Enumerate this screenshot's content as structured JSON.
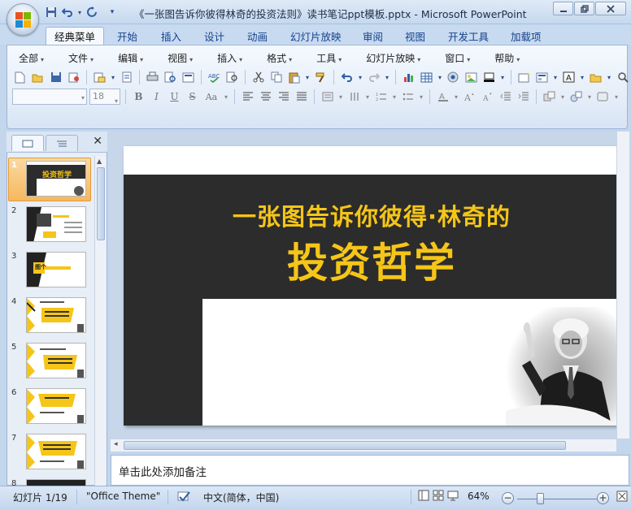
{
  "window": {
    "title": "《一张图告诉你彼得林奇的投资法则》读书笔记ppt模板.pptx - Microsoft PowerPoint",
    "controls": [
      "minimize",
      "restore",
      "close"
    ]
  },
  "quick_access": [
    "save-icon",
    "undo-icon",
    "redo-icon",
    "customize-icon"
  ],
  "ribbon_tabs": [
    "经典菜单",
    "开始",
    "插入",
    "设计",
    "动画",
    "幻灯片放映",
    "审阅",
    "视图",
    "开发工具",
    "加载项"
  ],
  "active_tab": "经典菜单",
  "menus": [
    "全部",
    "文件",
    "编辑",
    "视图",
    "插入",
    "格式",
    "工具",
    "幻灯片放映",
    "窗口",
    "帮助"
  ],
  "format_bar": {
    "font_name": "",
    "font_size": "18"
  },
  "slides_pane": {
    "thumbnails": [
      {
        "num": "1",
        "selected": true
      },
      {
        "num": "2",
        "selected": false
      },
      {
        "num": "3",
        "selected": false
      },
      {
        "num": "4",
        "selected": false
      },
      {
        "num": "5",
        "selected": false
      },
      {
        "num": "6",
        "selected": false
      },
      {
        "num": "7",
        "selected": false
      },
      {
        "num": "8",
        "selected": false
      }
    ],
    "thumb_texts": {
      "t1_title": "投资哲学",
      "t3_text": "图个"
    }
  },
  "slide": {
    "title_line1": "一张图告诉你彼得·林奇的",
    "title_line2": "投资哲学",
    "colors": {
      "dark": "#2c2c2c",
      "accent": "#f5c518"
    }
  },
  "notes": {
    "placeholder": "单击此处添加备注"
  },
  "status_bar": {
    "slide_info": "幻灯片 1/19",
    "theme": "\"Office Theme\"",
    "language": "中文(简体，中国)",
    "zoom": "64%"
  }
}
